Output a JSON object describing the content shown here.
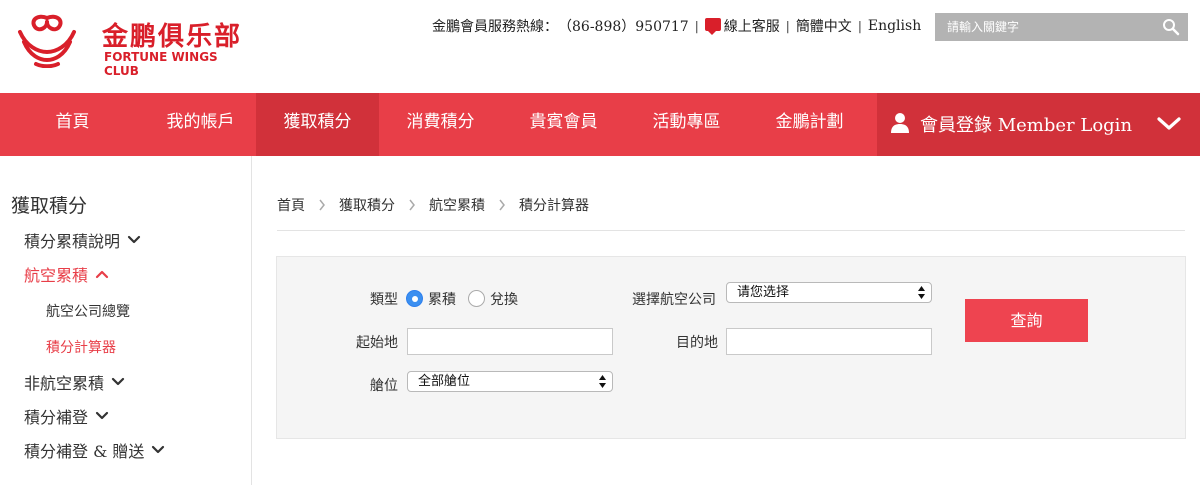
{
  "brand": {
    "name_cn": "金鹏俱乐部",
    "name_en": "FORTUNE WINGS CLUB",
    "color": "#d91f2a",
    "icon": "fortune-wings-logo-icon"
  },
  "header": {
    "hotline_label": "金鵬會員服務熱線：",
    "hotline_number": "（86-898）950717",
    "online_service": "線上客服",
    "lang_zh": "簡體中文",
    "lang_en": "English",
    "search_placeholder": "請輸入關鍵字",
    "chat_icon": "chat-bubble-icon",
    "search_icon": "magnifier-icon"
  },
  "nav": {
    "bg_color": "#e83e48",
    "active_color": "#d1313a",
    "items": [
      {
        "label": "首頁"
      },
      {
        "label": "我的帳戶"
      },
      {
        "label": "獲取積分",
        "active": true
      },
      {
        "label": "消費積分"
      },
      {
        "label": "貴賓會員"
      },
      {
        "label": "活動專區"
      },
      {
        "label": "金鵬計劃"
      }
    ],
    "login_label": "會員登錄 Member Login",
    "login_icon": "user-icon",
    "expand_icon": "chevron-down-icon"
  },
  "sidebar": {
    "title": "獲取積分",
    "items": [
      {
        "label": "積分累積說明",
        "expanded": false
      },
      {
        "label": "航空累積",
        "expanded": true,
        "active": true
      },
      {
        "label": "航空公司總覽",
        "sub": true
      },
      {
        "label": "積分計算器",
        "sub": true,
        "active": true
      },
      {
        "label": "非航空累積",
        "expanded": false
      },
      {
        "label": "積分補登",
        "expanded": false
      },
      {
        "label": "積分補登 & 贈送",
        "expanded": false
      }
    ]
  },
  "breadcrumb": [
    "首頁",
    "獲取積分",
    "航空累積",
    "積分計算器"
  ],
  "form": {
    "type_label": "類型",
    "type_options": [
      {
        "label": "累積",
        "selected": true
      },
      {
        "label": "兌換",
        "selected": false
      }
    ],
    "airline_label": "選擇航空公司",
    "airline_value": "请您选择",
    "origin_label": "起始地",
    "origin_value": "",
    "destination_label": "目的地",
    "destination_value": "",
    "cabin_label": "艙位",
    "cabin_value": "全部艙位",
    "submit_label": "查詢"
  }
}
